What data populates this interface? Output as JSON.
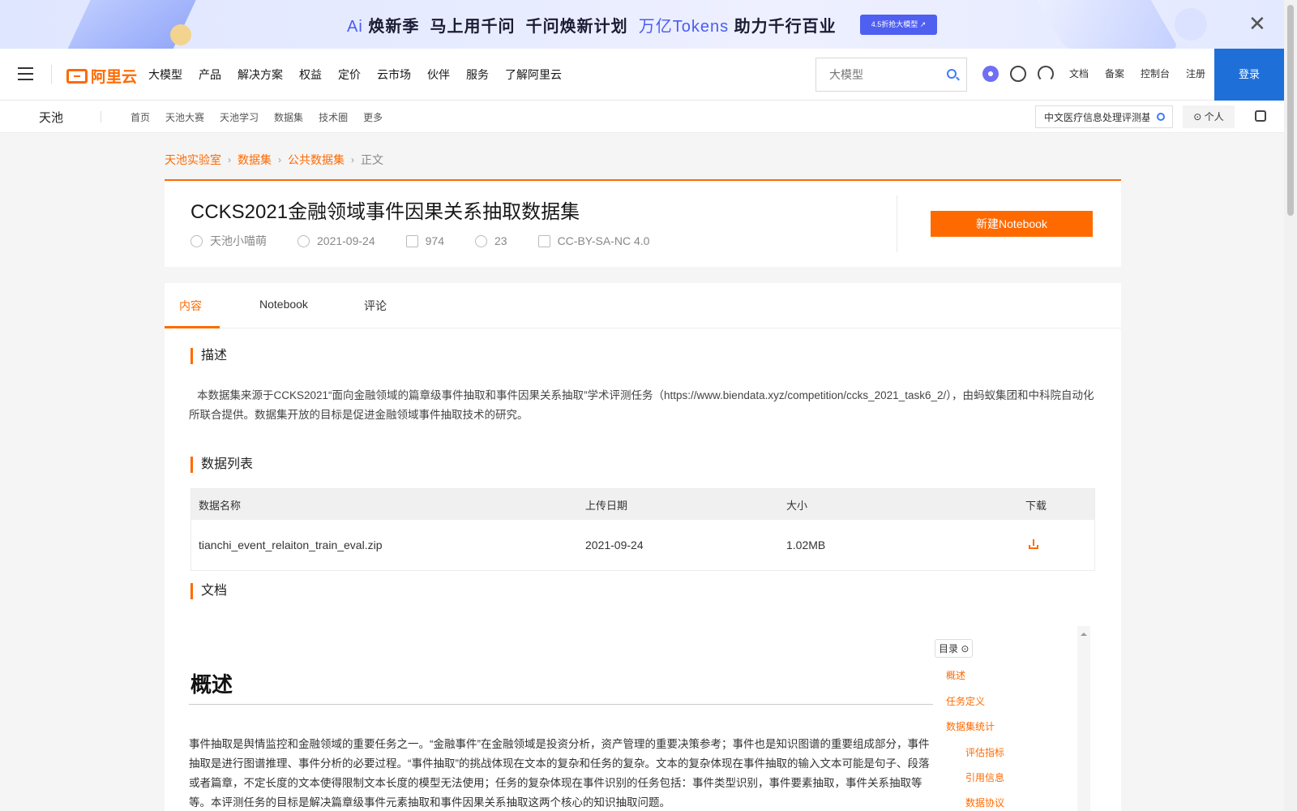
{
  "banner": {
    "ai_logo": "Ai",
    "segment1": "焕新季",
    "segment2": "马上用千问",
    "segment3": "千问焕新计划",
    "segment4": "万亿Tokens",
    "segment5": "助力千行百业",
    "cta_label": "4.5折抢大模型 ↗",
    "close_label": "✕"
  },
  "topnav": {
    "logo_text": "阿里云",
    "items": [
      "大模型",
      "产品",
      "解决方案",
      "权益",
      "定价",
      "云市场",
      "伙伴",
      "服务",
      "了解阿里云"
    ],
    "search_placeholder": "大模型",
    "links": [
      "文档",
      "备案",
      "控制台",
      "注册"
    ],
    "login_label": "登录"
  },
  "subnav": {
    "brand": "天池",
    "links": [
      "首页",
      "天池大赛",
      "天池学习",
      "数据集",
      "技术圈",
      "更多"
    ],
    "search_value": "中文医疗信息处理评测基",
    "personal_label": "个人"
  },
  "breadcrumb": {
    "items": [
      "天池实验室",
      "数据集",
      "公共数据集"
    ],
    "current": "正文"
  },
  "dataset": {
    "title": "CCKS2021金融领域事件因果关系抽取数据集",
    "author": "天池小喵萌",
    "date": "2021-09-24",
    "downloads": "974",
    "shares": "23",
    "license": "CC-BY-SA-NC 4.0",
    "new_notebook_label": "新建Notebook"
  },
  "tabs": [
    "内容",
    "Notebook",
    "评论"
  ],
  "sections": {
    "description_title": "描述",
    "description_text": "本数据集来源于CCKS2021“面向金融领域的篇章级事件抽取和事件因果关系抽取”学术评测任务（https://www.biendata.xyz/competition/ccks_2021_task6_2/），由蚂蚁集团和中科院自动化所联合提供。数据集开放的目标是促进金融领域事件抽取技术的研究。",
    "datalist_title": "数据列表",
    "doc_title": "文档"
  },
  "table": {
    "headers": [
      "数据名称",
      "上传日期",
      "大小",
      "下载"
    ],
    "rows": [
      {
        "name": "tianchi_event_relaiton_train_eval.zip",
        "date": "2021-09-24",
        "size": "1.02MB"
      }
    ]
  },
  "doc": {
    "h1": "概述",
    "paragraph": "事件抽取是舆情监控和金融领域的重要任务之一。“金融事件”在金融领域是投资分析，资产管理的重要决策参考；事件也是知识图谱的重要组成部分，事件抽取是进行图谱推理、事件分析的必要过程。“事件抽取”的挑战体现在文本的复杂和任务的复杂。文本的复杂体现在事件抽取的输入文本可能是句子、段落或者篇章，不定长度的文本使得限制文本长度的模型无法使用；任务的复杂体现在事件识别的任务包括：事件类型识别，事件要素抽取，事件关系抽取等等。本评测任务的目标是解决篇章级事件元素抽取和事件因果关系抽取这两个核心的知识抽取问题。",
    "toc_label": "目录",
    "toc": [
      "概述",
      "任务定义",
      "数据集统计",
      "评估指标",
      "引用信息",
      "数据协议"
    ]
  },
  "colors": {
    "accent": "#ff6a00",
    "login_bg": "#1f6fd8",
    "banner_accent": "#4a5df0"
  }
}
